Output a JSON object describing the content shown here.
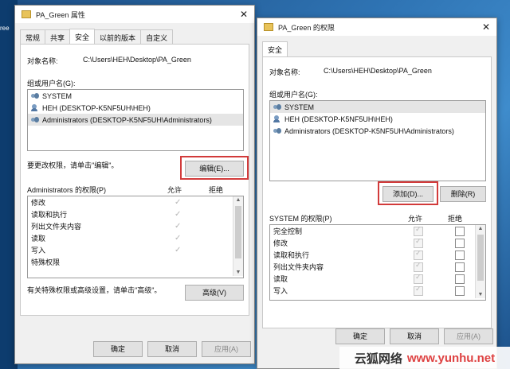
{
  "desktop": {
    "side_text": "ree"
  },
  "win1": {
    "title": "PA_Green 属性",
    "tabs": [
      "常规",
      "共享",
      "安全",
      "以前的版本",
      "自定义"
    ],
    "object_label": "对象名称:",
    "object_value": "C:\\Users\\HEH\\Desktop\\PA_Green",
    "group_label": "组或用户名(G):",
    "users": [
      "SYSTEM",
      "HEH (DESKTOP-K5NF5UH\\HEH)",
      "Administrators (DESKTOP-K5NF5UH\\Administrators)"
    ],
    "change_hint": "要更改权限，请单击\"编辑\"。",
    "edit_button": "编辑(E)...",
    "perm_header": "Administrators 的权限(P)",
    "allow": "允许",
    "deny": "拒绝",
    "permissions": [
      "修改",
      "读取和执行",
      "列出文件夹内容",
      "读取",
      "写入",
      "特殊权限"
    ],
    "advanced_hint": "有关特殊权限或高级设置，请单击\"高级\"。",
    "advanced_button": "高级(V)",
    "ok": "确定",
    "cancel": "取消",
    "apply": "应用(A)"
  },
  "win2": {
    "title": "PA_Green 的权限",
    "tab": "安全",
    "object_label": "对象名称:",
    "object_value": "C:\\Users\\HEH\\Desktop\\PA_Green",
    "group_label": "组或用户名(G):",
    "users": [
      "SYSTEM",
      "HEH (DESKTOP-K5NF5UH\\HEH)",
      "Administrators (DESKTOP-K5NF5UH\\Administrators)"
    ],
    "add_button": "添加(D)...",
    "remove_button": "删除(R)",
    "perm_header": "SYSTEM 的权限(P)",
    "allow": "允许",
    "deny": "拒绝",
    "permissions": [
      "完全控制",
      "修改",
      "读取和执行",
      "列出文件夹内容",
      "读取",
      "写入"
    ],
    "ok": "确定",
    "cancel": "取消",
    "apply": "应用(A)"
  },
  "watermark": {
    "cn": "云狐网络",
    "url": "www.yunhu.net"
  }
}
